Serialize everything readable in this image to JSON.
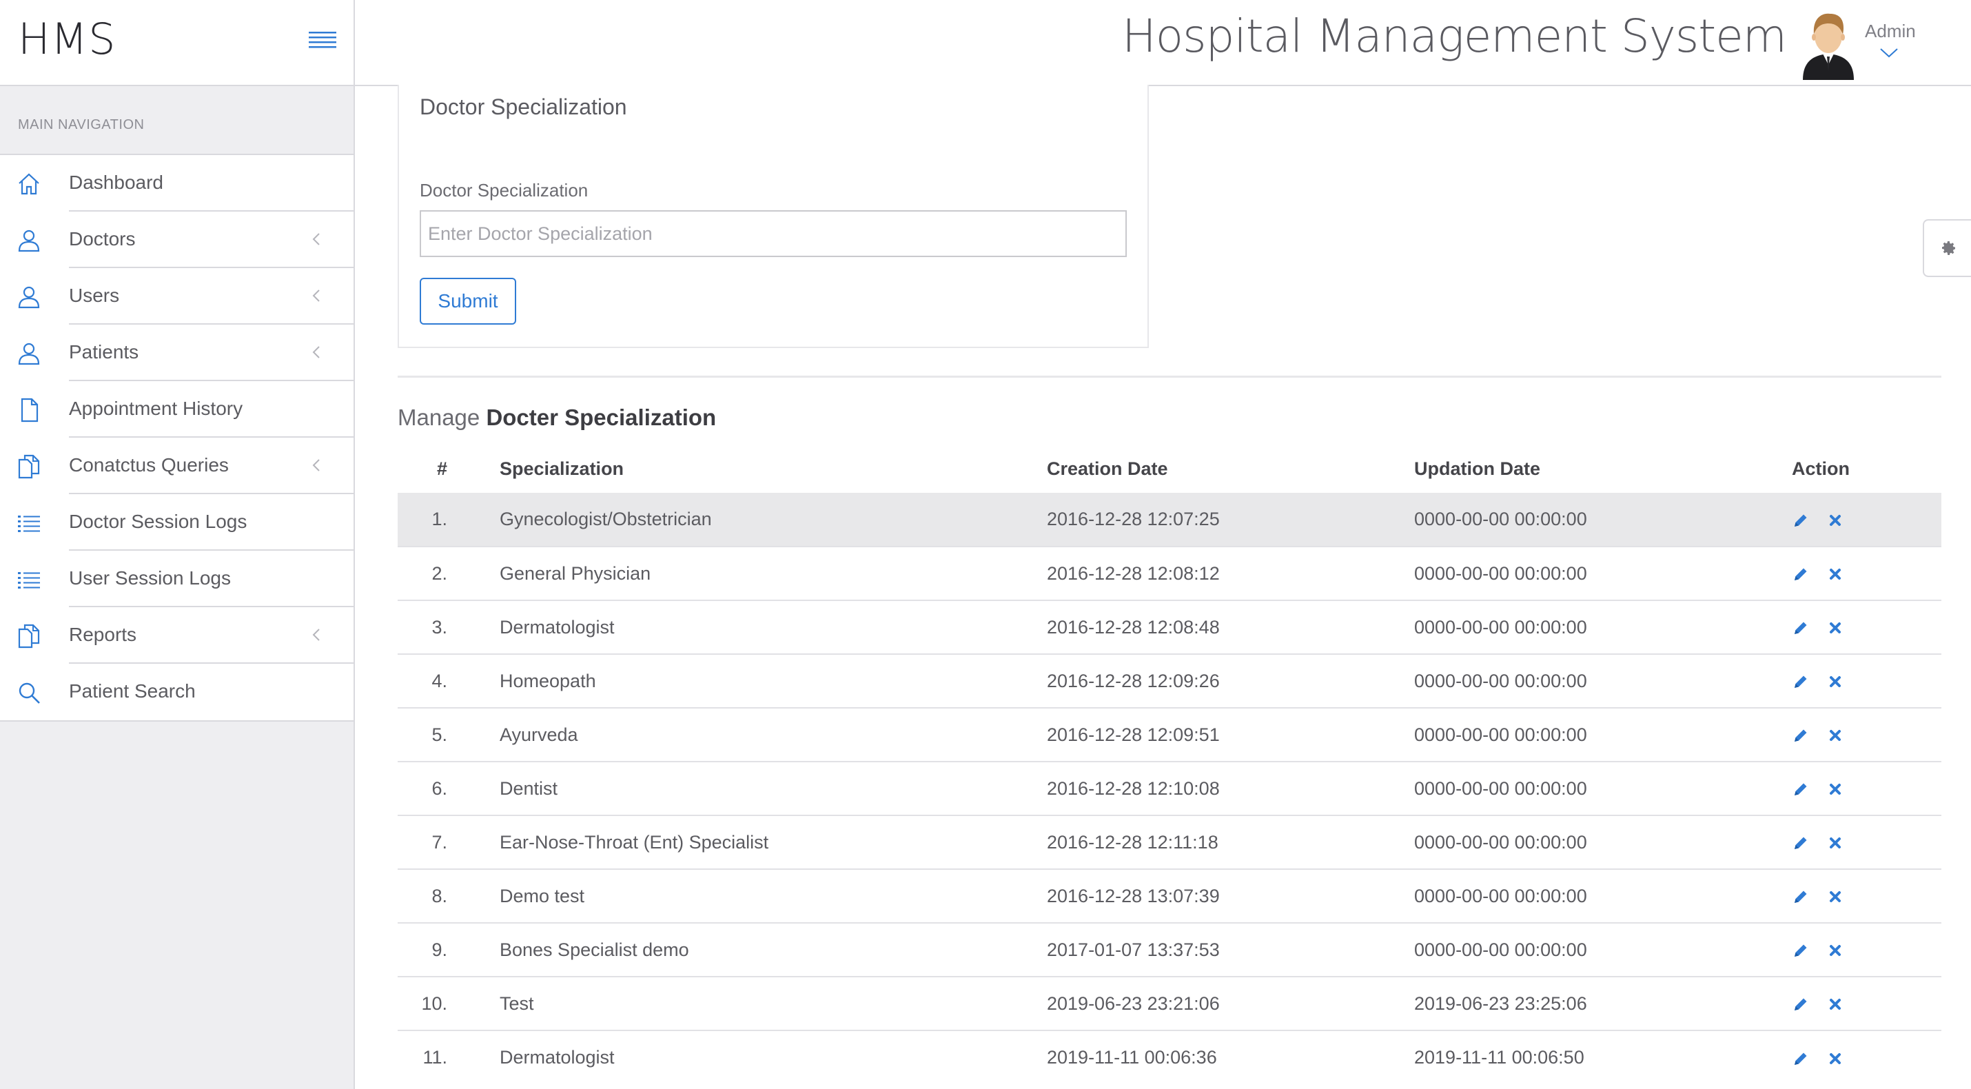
{
  "header": {
    "brand": "HMS",
    "title": "Hospital Management System",
    "user": "Admin"
  },
  "sidebar": {
    "heading": "MAIN NAVIGATION",
    "items": [
      {
        "label": "Dashboard",
        "icon": "home-icon",
        "has_arrow": false
      },
      {
        "label": "Doctors",
        "icon": "user-icon",
        "has_arrow": true
      },
      {
        "label": "Users",
        "icon": "user-icon",
        "has_arrow": true
      },
      {
        "label": "Patients",
        "icon": "user-icon",
        "has_arrow": true
      },
      {
        "label": "Appointment History",
        "icon": "file-icon",
        "has_arrow": false
      },
      {
        "label": "Conatctus Queries",
        "icon": "files-icon",
        "has_arrow": true
      },
      {
        "label": "Doctor Session Logs",
        "icon": "list-icon",
        "has_arrow": false
      },
      {
        "label": "User Session Logs",
        "icon": "list-icon",
        "has_arrow": false
      },
      {
        "label": "Reports",
        "icon": "files-icon",
        "has_arrow": true
      },
      {
        "label": "Patient Search",
        "icon": "search-icon",
        "has_arrow": false
      }
    ]
  },
  "form": {
    "title": "Doctor Specialization",
    "field_label": "Doctor Specialization",
    "placeholder": "Enter Doctor Specialization",
    "value": "",
    "submit_label": "Submit"
  },
  "manage": {
    "prefix": "Manage",
    "title": "Docter Specialization"
  },
  "table": {
    "headers": [
      "#",
      "Specialization",
      "Creation Date",
      "Updation Date",
      "Action"
    ],
    "rows": [
      {
        "num": "1.",
        "spec": "Gynecologist/Obstetrician",
        "created": "2016-12-28 12:07:25",
        "updated": "0000-00-00 00:00:00"
      },
      {
        "num": "2.",
        "spec": "General Physician",
        "created": "2016-12-28 12:08:12",
        "updated": "0000-00-00 00:00:00"
      },
      {
        "num": "3.",
        "spec": "Dermatologist",
        "created": "2016-12-28 12:08:48",
        "updated": "0000-00-00 00:00:00"
      },
      {
        "num": "4.",
        "spec": "Homeopath",
        "created": "2016-12-28 12:09:26",
        "updated": "0000-00-00 00:00:00"
      },
      {
        "num": "5.",
        "spec": "Ayurveda",
        "created": "2016-12-28 12:09:51",
        "updated": "0000-00-00 00:00:00"
      },
      {
        "num": "6.",
        "spec": "Dentist",
        "created": "2016-12-28 12:10:08",
        "updated": "0000-00-00 00:00:00"
      },
      {
        "num": "7.",
        "spec": "Ear-Nose-Throat (Ent) Specialist",
        "created": "2016-12-28 12:11:18",
        "updated": "0000-00-00 00:00:00"
      },
      {
        "num": "8.",
        "spec": "Demo test",
        "created": "2016-12-28 13:07:39",
        "updated": "0000-00-00 00:00:00"
      },
      {
        "num": "9.",
        "spec": "Bones Specialist demo",
        "created": "2017-01-07 13:37:53",
        "updated": "0000-00-00 00:00:00"
      },
      {
        "num": "10.",
        "spec": "Test",
        "created": "2019-06-23 23:21:06",
        "updated": "2019-06-23 23:25:06"
      },
      {
        "num": "11.",
        "spec": "Dermatologist",
        "created": "2019-11-11 00:06:36",
        "updated": "2019-11-11 00:06:50"
      }
    ]
  },
  "colors": {
    "accent": "#2f7bd4",
    "sidebar_bg": "#eeeef1",
    "highlight_row": "#e8e8ea"
  }
}
